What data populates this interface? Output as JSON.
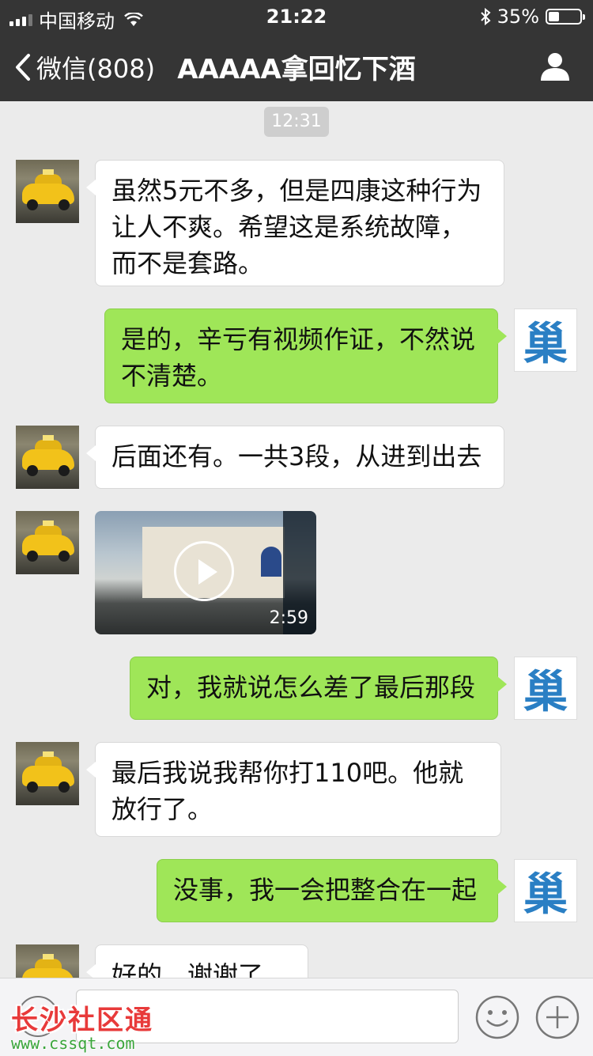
{
  "status_bar": {
    "carrier": "中国移动",
    "time": "21:22",
    "battery": "35%",
    "battery_level": 0.35,
    "icons": [
      "signal-icon",
      "wifi-icon",
      "bluetooth-icon",
      "battery-icon"
    ]
  },
  "nav": {
    "back_label": "微信(808)",
    "title": "AAAAA拿回忆下酒",
    "icons": [
      "chevron-left-icon",
      "profile-icon"
    ]
  },
  "timestamp": "12:31",
  "messages": [
    {
      "side": "in",
      "text": "虽然5元不多，但是四康这种行为让人不爽。希望这是系统故障，而不是套路。"
    },
    {
      "side": "out",
      "text": "是的，辛亏有视频作证，不然说不清楚。"
    },
    {
      "side": "in",
      "text": "后面还有。一共3段，从进到出去"
    },
    {
      "side": "in",
      "type": "video",
      "duration": "2:59"
    },
    {
      "side": "out",
      "text": "对，我就说怎么差了最后那段"
    },
    {
      "side": "in",
      "text": "最后我说我帮你打110吧。他就放行了。"
    },
    {
      "side": "out",
      "text": "没事，我一会把整合在一起"
    },
    {
      "side": "in",
      "text": "好的，谢谢了"
    }
  ],
  "self_avatar_glyph": "巢",
  "colors": {
    "nav_bg": "#353535",
    "out_bubble": "#9fe658",
    "chat_bg": "#ebebeb"
  },
  "input_bar": {
    "icons": [
      "voice-icon",
      "emoji-icon",
      "plus-icon"
    ]
  },
  "watermark": {
    "title": "长沙社区通",
    "url": "www.cssqt.com"
  }
}
